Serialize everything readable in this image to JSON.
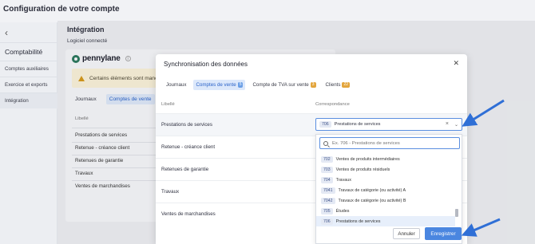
{
  "page": {
    "title": "Configuration de votre compte"
  },
  "sidebar": {
    "back_icon": "chevron-left-icon",
    "heading": "Comptabilité",
    "items": [
      {
        "label": "Comptes auxiliaires"
      },
      {
        "label": "Exercice et exports"
      },
      {
        "label": "Intégration",
        "active": true
      }
    ]
  },
  "main": {
    "section_title": "Intégration",
    "section_subtitle": "Logiciel connecté",
    "brand": "pennylane",
    "warning_text": "Certains éléments sont manquan",
    "tabs": [
      {
        "label": "Journaux"
      },
      {
        "label": "Comptes de vente",
        "active": true
      }
    ],
    "col_header": "Libellé",
    "rows": [
      "Prestations de services",
      "Retenue - créance client",
      "Retenues de garantie",
      "Travaux",
      "Ventes de marchandises"
    ]
  },
  "modal": {
    "title": "Synchronisation des données",
    "close_icon": "close-icon",
    "tabs": [
      {
        "label": "Journaux",
        "badge": ""
      },
      {
        "label": "Comptes de vente",
        "badge": "5",
        "active": true
      },
      {
        "label": "Compte de TVA sur vente",
        "badge": "3"
      },
      {
        "label": "Clients",
        "badge": "22"
      }
    ],
    "col_libelle": "Libellé",
    "col_correspondance": "Correspondance",
    "rows": [
      {
        "label": "Prestations de services"
      },
      {
        "label": "Retenue - créance client"
      },
      {
        "label": "Retenues de garantie"
      },
      {
        "label": "Travaux"
      },
      {
        "label": "Ventes de marchandises"
      }
    ],
    "select": {
      "code": "706",
      "value": "Prestations de services"
    },
    "dropdown": {
      "search_placeholder": "Ex. 706 - Prestations de services",
      "options": [
        {
          "code": "702",
          "label": "Ventes de produits intermédiaires"
        },
        {
          "code": "703",
          "label": "Ventes de produits résiduels"
        },
        {
          "code": "704",
          "label": "Travaux"
        },
        {
          "code": "7041",
          "label": "Travaux de catégorie (ou activité) A"
        },
        {
          "code": "7042",
          "label": "Travaux de catégorie (ou activité) B"
        },
        {
          "code": "705",
          "label": "Études"
        },
        {
          "code": "706",
          "label": "Prestations de services",
          "selected": true
        }
      ]
    },
    "cancel_label": "Annuler",
    "save_label": "Enregistrer"
  },
  "colors": {
    "accent": "#4a86e0",
    "arrow": "#2f6fd6",
    "warning_bg": "#fbf3d9",
    "badge": "#e3a53c"
  }
}
